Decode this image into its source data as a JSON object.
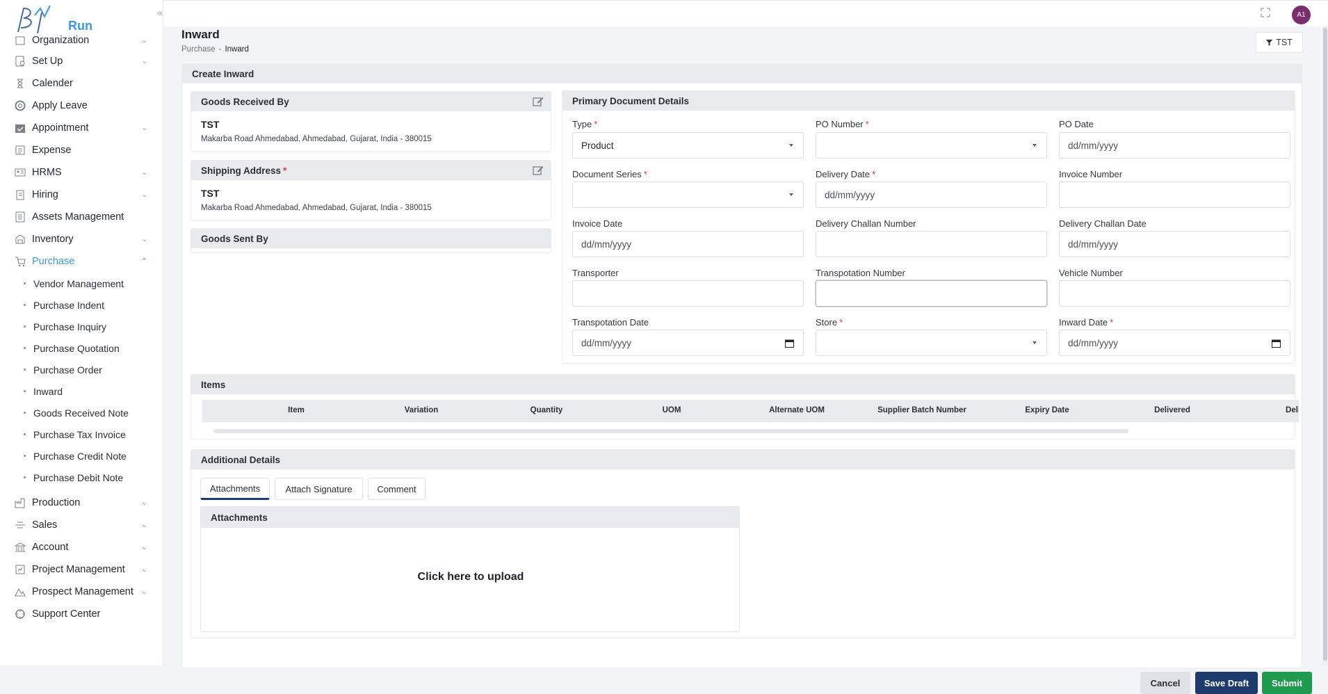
{
  "app": {
    "logo_text": "Run",
    "user_initials": "A1"
  },
  "sidebar": {
    "items": [
      {
        "label": "Organization",
        "icon": "building-icon",
        "chevron": true
      },
      {
        "label": "Set Up",
        "icon": "setup-icon",
        "chevron": true
      },
      {
        "label": "Calender",
        "icon": "hourglass-icon",
        "chevron": false
      },
      {
        "label": "Apply Leave",
        "icon": "lifebuoy-icon",
        "chevron": false
      },
      {
        "label": "Appointment",
        "icon": "calendar-check-icon",
        "chevron": true
      },
      {
        "label": "Expense",
        "icon": "expense-icon",
        "chevron": false
      },
      {
        "label": "HRMS",
        "icon": "hrms-icon",
        "chevron": true
      },
      {
        "label": "Hiring",
        "icon": "hiring-icon",
        "chevron": true
      },
      {
        "label": "Assets Management",
        "icon": "assets-icon",
        "chevron": false
      },
      {
        "label": "Inventory",
        "icon": "inventory-icon",
        "chevron": true
      },
      {
        "label": "Purchase",
        "icon": "cart-icon",
        "chevron": true,
        "active": true
      }
    ],
    "purchase_sub": [
      "Vendor Management",
      "Purchase Indent",
      "Purchase Inquiry",
      "Purchase Quotation",
      "Purchase Order",
      "Inward",
      "Goods Received Note",
      "Purchase Tax Invoice",
      "Purchase Credit Note",
      "Purchase Debit Note"
    ],
    "items_after": [
      {
        "label": "Production",
        "icon": "factory-icon",
        "chevron": true
      },
      {
        "label": "Sales",
        "icon": "sales-icon",
        "chevron": true
      },
      {
        "label": "Account",
        "icon": "bank-icon",
        "chevron": true
      },
      {
        "label": "Project Management",
        "icon": "project-icon",
        "chevron": true
      },
      {
        "label": "Prospect Management",
        "icon": "prospect-icon",
        "chevron": true
      },
      {
        "label": "Support Center",
        "icon": "support-icon",
        "chevron": false
      }
    ]
  },
  "page": {
    "title": "Inward",
    "breadcrumb": {
      "parent": "Purchase",
      "separator": "-",
      "current": "Inward"
    },
    "filter_label": "TST",
    "form_title": "Create Inward"
  },
  "goods_received": {
    "title": "Goods Received By",
    "name": "TST",
    "address": "Makarba Road Ahmedabad, Ahmedabad, Gujarat, India - 380015"
  },
  "shipping": {
    "title": "Shipping Address",
    "name": "TST",
    "address": "Makarba Road Ahmedabad, Ahmedabad, Gujarat, India - 380015"
  },
  "goods_sent": {
    "title": "Goods Sent By"
  },
  "primary": {
    "title": "Primary Document Details",
    "fields": {
      "type": {
        "label": "Type",
        "value": "Product"
      },
      "po_number": {
        "label": "PO Number",
        "value": ""
      },
      "po_date": {
        "label": "PO Date",
        "placeholder": "dd/mm/yyyy"
      },
      "doc_series": {
        "label": "Document Series",
        "value": ""
      },
      "delivery_date": {
        "label": "Delivery Date",
        "placeholder": "dd/mm/yyyy"
      },
      "invoice_number": {
        "label": "Invoice Number",
        "value": ""
      },
      "invoice_date": {
        "label": "Invoice Date",
        "placeholder": "dd/mm/yyyy"
      },
      "challan_number": {
        "label": "Delivery Challan Number",
        "value": ""
      },
      "challan_date": {
        "label": "Delivery Challan Date",
        "placeholder": "dd/mm/yyyy"
      },
      "transporter": {
        "label": "Transporter",
        "value": ""
      },
      "transport_number": {
        "label": "Transpotation Number",
        "value": ""
      },
      "vehicle_number": {
        "label": "Vehicle Number",
        "value": ""
      },
      "transport_date": {
        "label": "Transpotation Date",
        "placeholder": "dd/mm/yyyy"
      },
      "store": {
        "label": "Store",
        "value": ""
      },
      "inward_date": {
        "label": "Inward Date",
        "placeholder": "dd/mm/yyyy"
      }
    }
  },
  "items": {
    "title": "Items",
    "columns": [
      "Item",
      "Variation",
      "Quantity",
      "UOM",
      "Alternate UOM",
      "Supplier Batch Number",
      "Expiry Date",
      "Delivered",
      "Delive"
    ]
  },
  "additional": {
    "title": "Additional Details",
    "tabs": [
      "Attachments",
      "Attach Signature",
      "Comment"
    ],
    "attachments_title": "Attachments",
    "upload_text": "Click here to upload"
  },
  "actions": {
    "cancel": "Cancel",
    "save_draft": "Save Draft",
    "submit": "Submit"
  },
  "colors": {
    "accent": "#3a9ce0",
    "primary_button": "#1f3b6e",
    "submit_button": "#1f9a4e",
    "required": "#e23b3b"
  }
}
